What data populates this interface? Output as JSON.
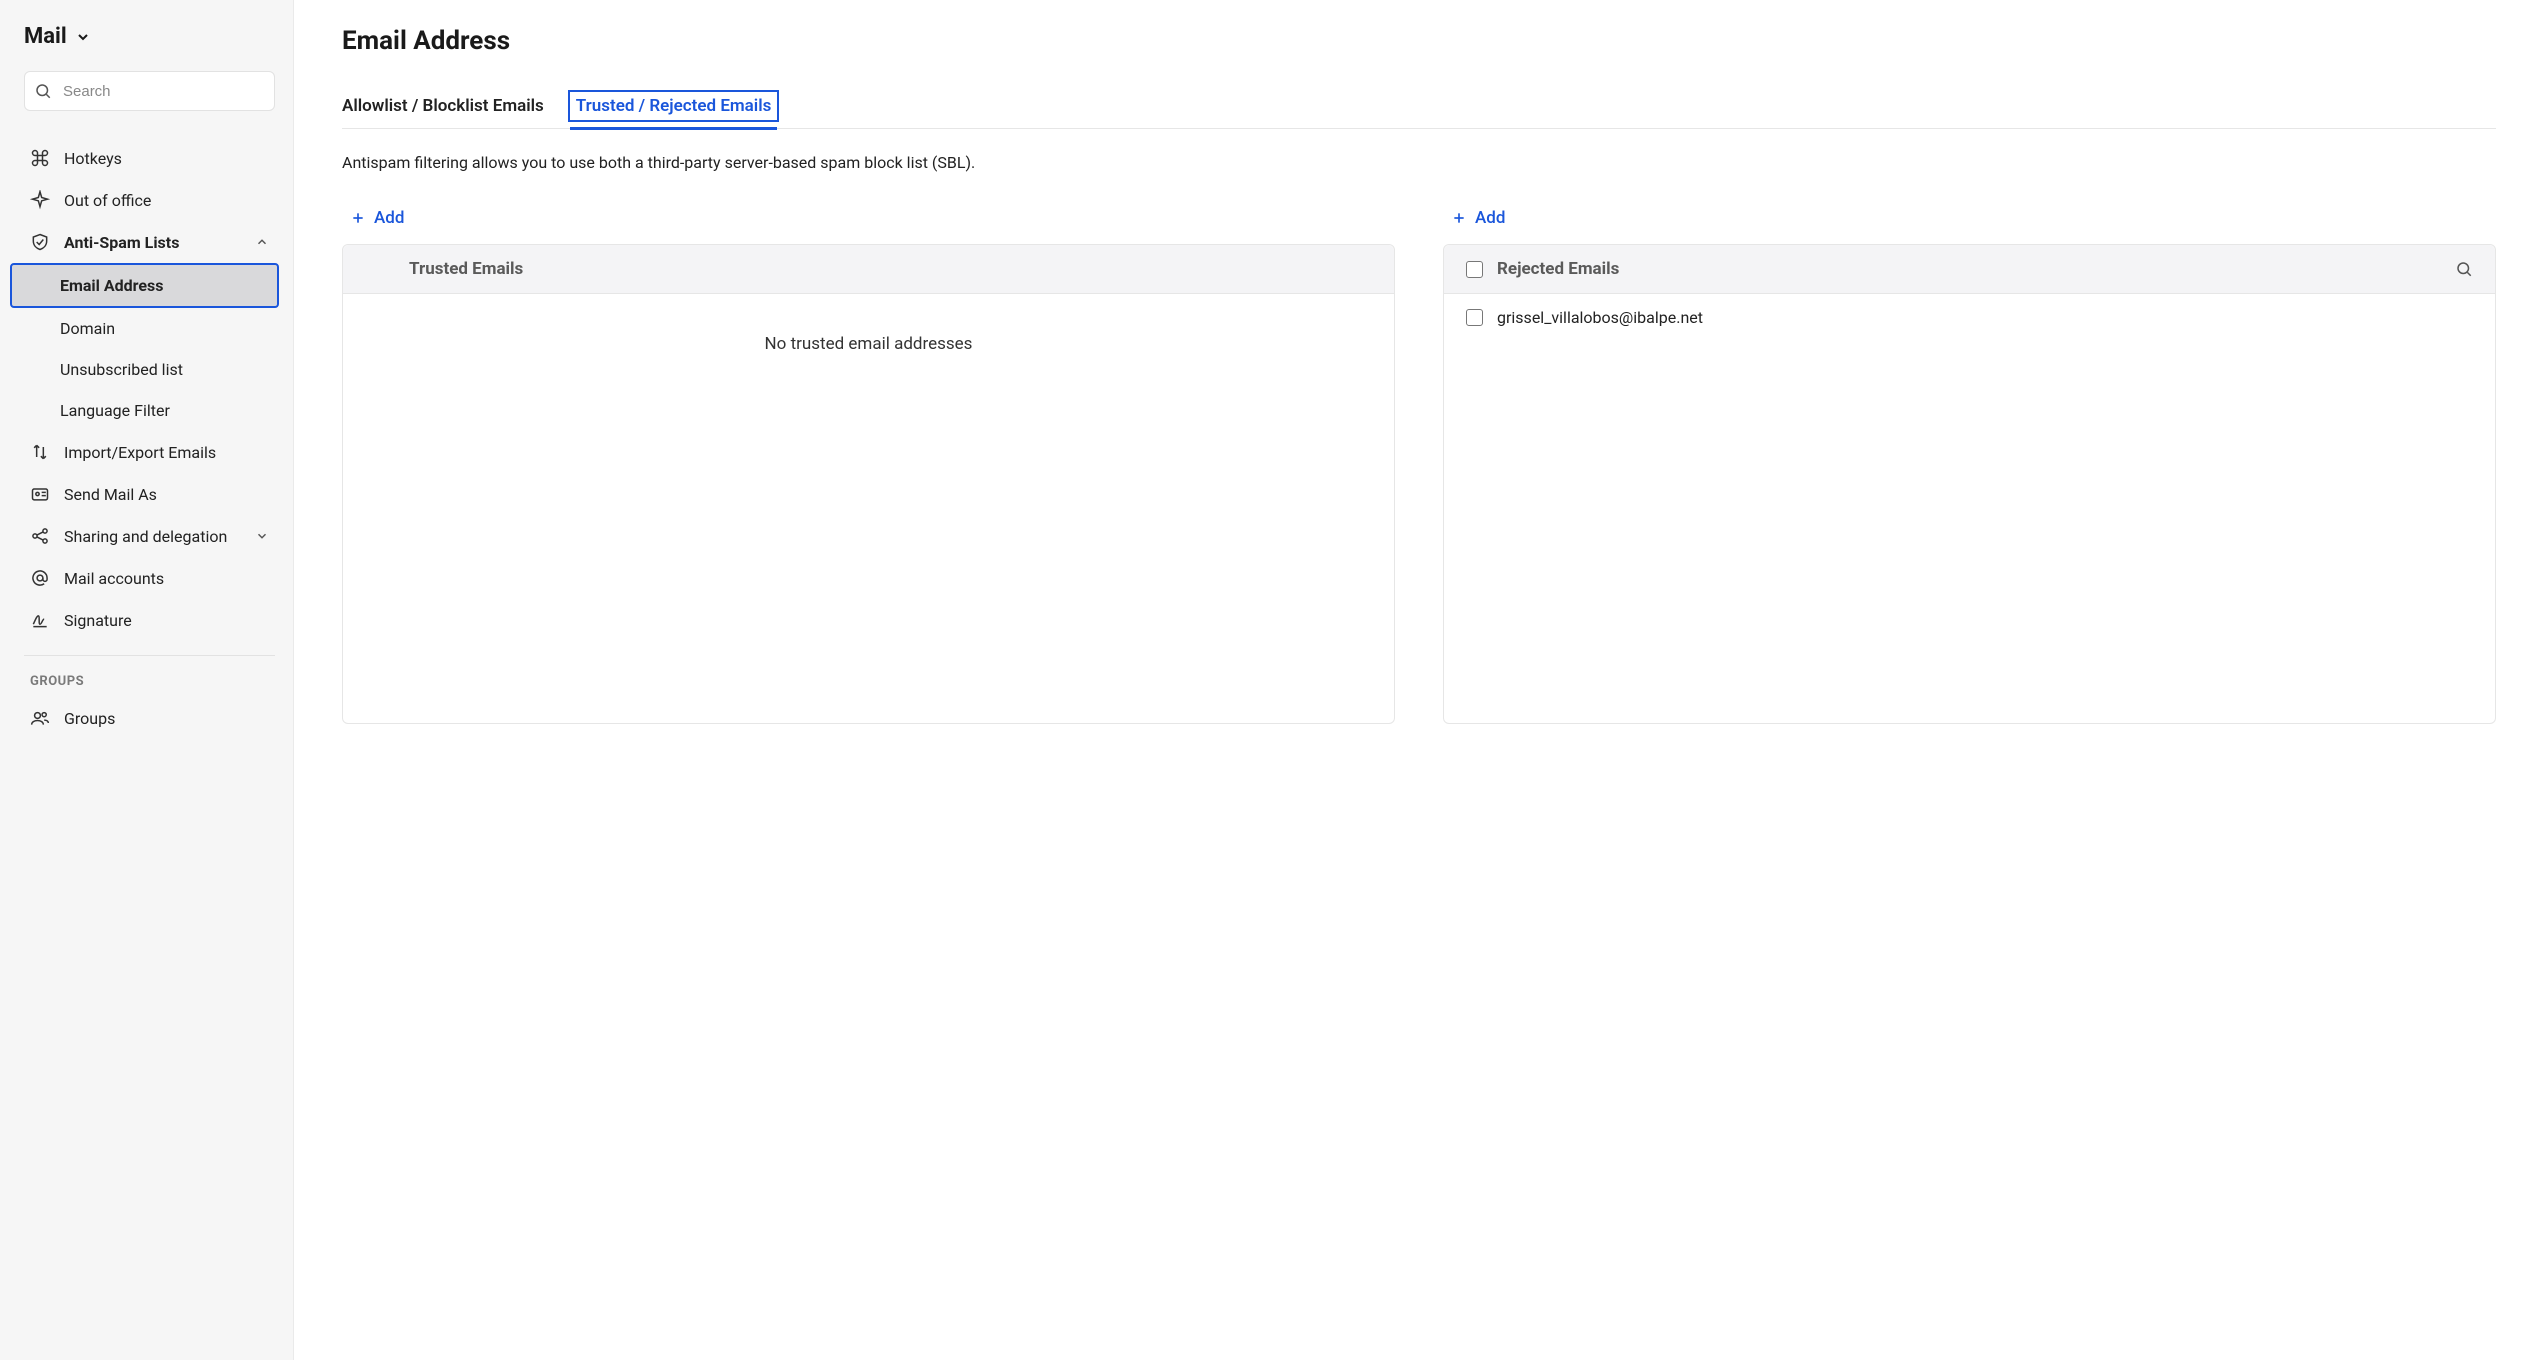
{
  "sidebar": {
    "title": "Mail",
    "search_placeholder": "Search",
    "items": [
      {
        "label": "Hotkeys"
      },
      {
        "label": "Out of office"
      },
      {
        "label": "Anti-Spam Lists"
      },
      {
        "label": "Import/Export Emails"
      },
      {
        "label": "Send Mail As"
      },
      {
        "label": "Sharing and delegation"
      },
      {
        "label": "Mail accounts"
      },
      {
        "label": "Signature"
      }
    ],
    "antispam_sub": [
      {
        "label": "Email Address"
      },
      {
        "label": "Domain"
      },
      {
        "label": "Unsubscribed list"
      },
      {
        "label": "Language Filter"
      }
    ],
    "groups_header": "GROUPS",
    "groups_item": "Groups"
  },
  "main": {
    "title": "Email Address",
    "tabs": [
      {
        "label": "Allowlist / Blocklist Emails"
      },
      {
        "label": "Trusted / Rejected Emails"
      }
    ],
    "description": "Antispam filtering allows you to use both a third-party server-based spam block list (SBL).",
    "add_label": "Add",
    "trusted": {
      "header": "Trusted Emails",
      "empty": "No trusted email addresses"
    },
    "rejected": {
      "header": "Rejected Emails",
      "items": [
        "grissel_villalobos@ibalpe.net"
      ]
    }
  }
}
